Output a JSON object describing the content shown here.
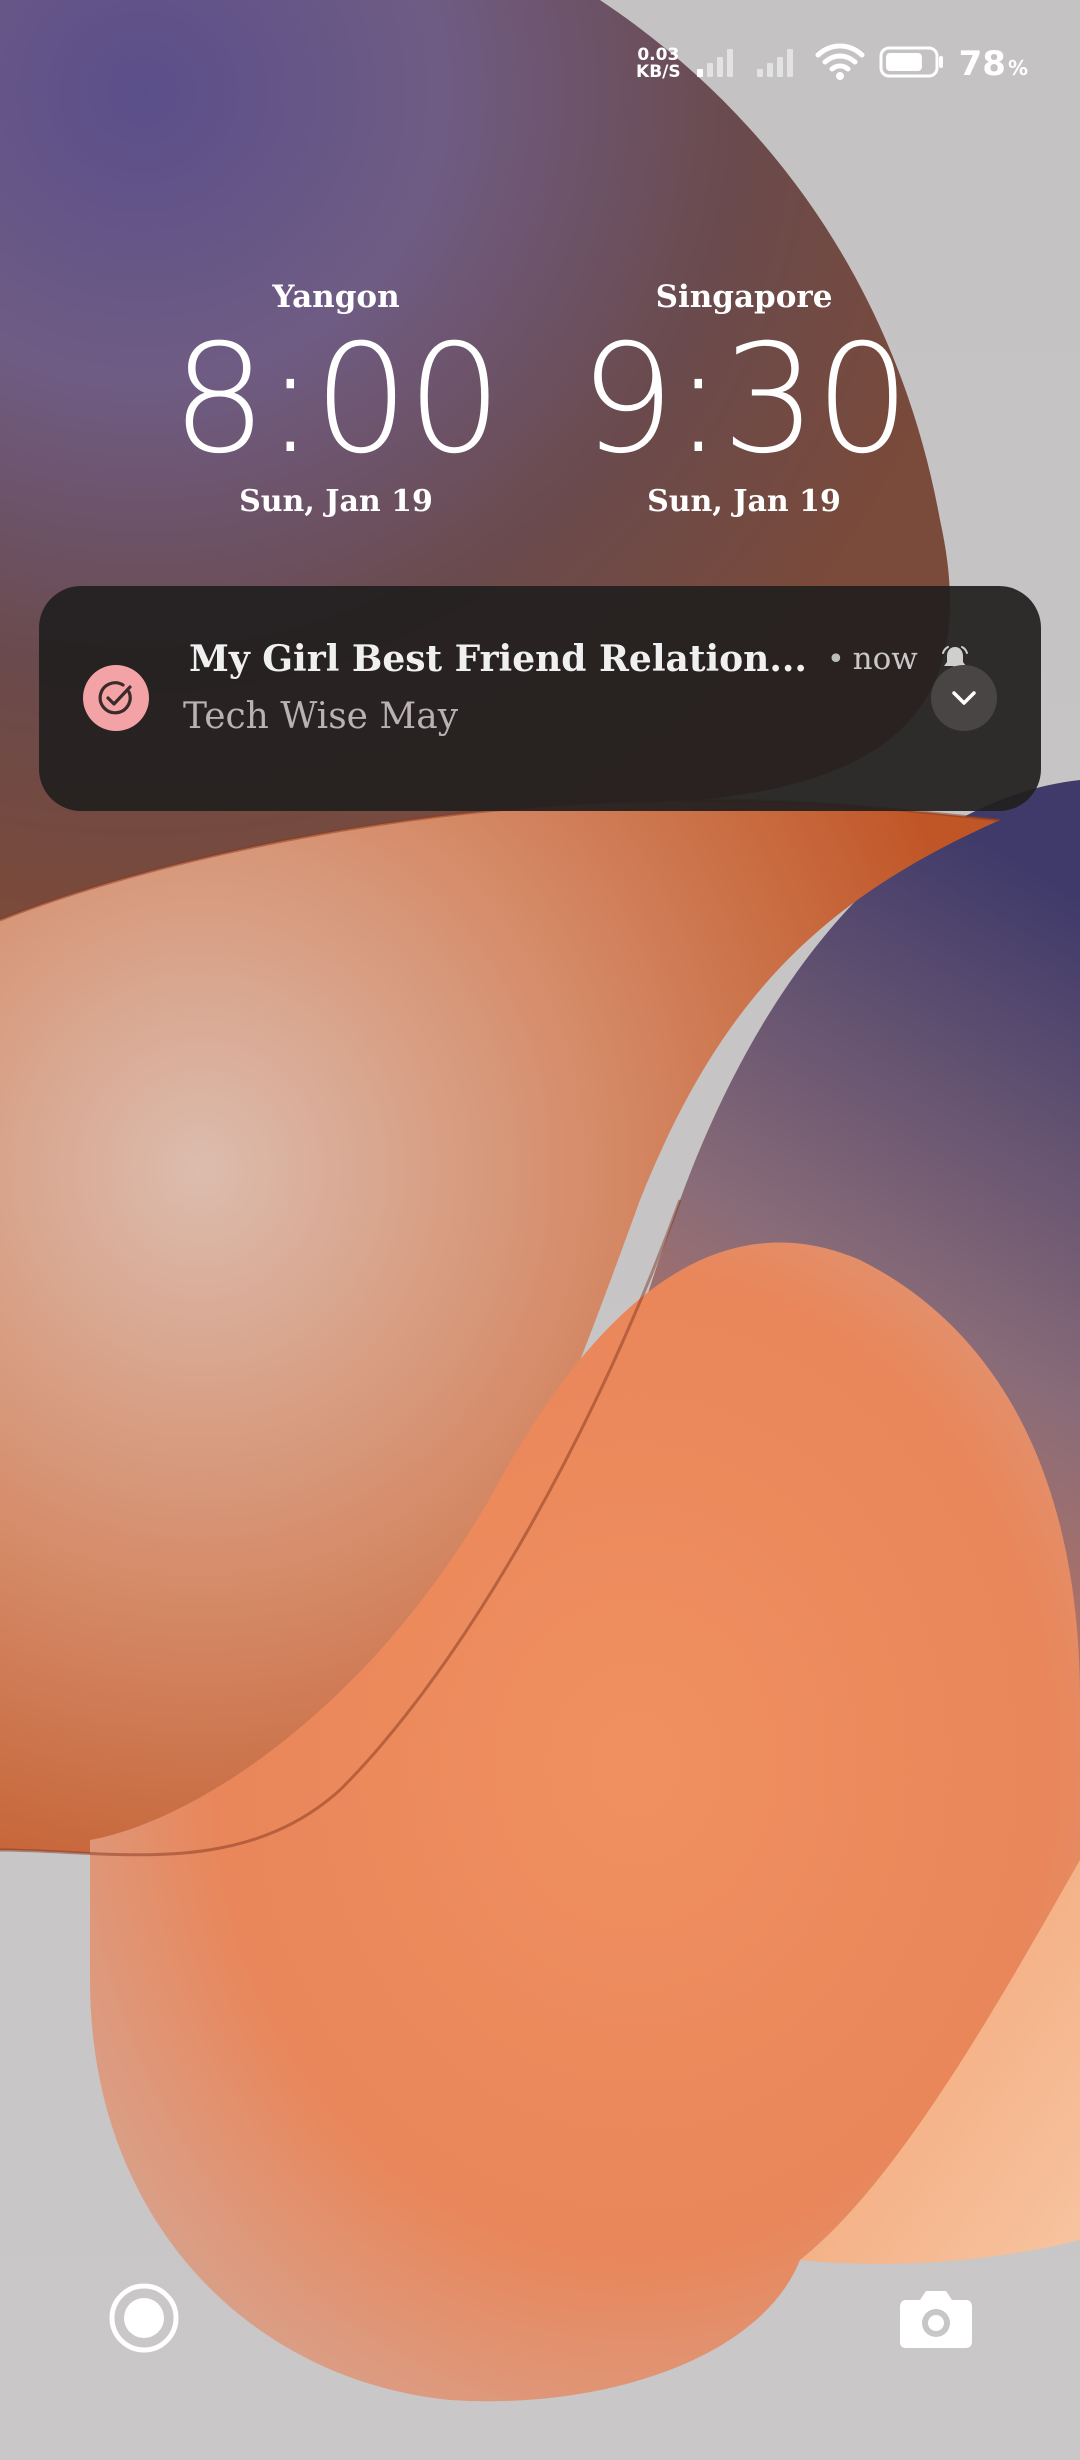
{
  "status_bar": {
    "net_speed_value": "0.03",
    "net_speed_unit": "KB/S",
    "battery_percent": "78",
    "battery_percent_sign": "%",
    "battery_level": 0.78,
    "icons": [
      "signal-1-icon",
      "signal-2-icon",
      "wifi-icon",
      "battery-icon"
    ]
  },
  "clocks": [
    {
      "city": "Yangon",
      "time": "8:00",
      "date": "Sun, Jan 19"
    },
    {
      "city": "Singapore",
      "time": "9:30",
      "date": "Sun, Jan 19"
    }
  ],
  "notification": {
    "app_icon": "check-circle-icon",
    "app_icon_color": "#f3a3a6",
    "title": "My Girl Best Friend Relation...",
    "separator": "•",
    "time": "now",
    "alert_icon": "bell-icon",
    "body": "Tech Wise  May",
    "expand_icon": "chevron-down-icon"
  },
  "shortcuts": {
    "left_icon": "voice-assistant-icon",
    "right_icon": "camera-icon"
  },
  "colors": {
    "notification_bg": "#221f1f",
    "text": "#ffffff"
  }
}
